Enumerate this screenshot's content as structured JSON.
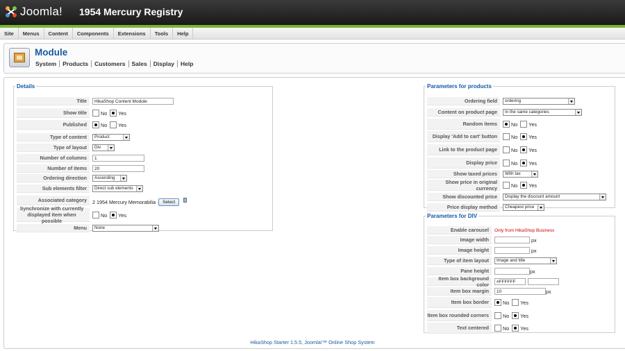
{
  "header": {
    "logo_text": "Joomla!",
    "site_title": "1954 Mercury Registry"
  },
  "menu": [
    "Site",
    "Menus",
    "Content",
    "Components",
    "Extensions",
    "Tools",
    "Help"
  ],
  "toolbar": {
    "title": "Module",
    "subnav": [
      "System",
      "Products",
      "Customers",
      "Sales",
      "Display",
      "Help"
    ]
  },
  "details": {
    "legend": "Details",
    "title_label": "Title",
    "title_value": "HikaShop Content Module",
    "show_title_label": "Show title",
    "published_label": "Published",
    "no": "No",
    "yes": "Yes",
    "type_content_label": "Type of content",
    "type_content_value": "Product",
    "type_layout_label": "Type of layout",
    "type_layout_value": "Div",
    "num_columns_label": "Number of columns",
    "num_columns_value": "1",
    "num_items_label": "Number of items",
    "num_items_value": "20",
    "ordering_dir_label": "Ordering direction",
    "ordering_dir_value": "Ascending",
    "sub_filter_label": "Sub elements filter",
    "sub_filter_value": "Direct sub elements",
    "assoc_cat_label": "Associated category",
    "assoc_cat_value": "2 1954 Mercury Memorabilia",
    "select_btn": "Select",
    "sync_label": "Synchronize with currently displayed item when possible",
    "menu_label": "Menu",
    "menu_value": "None"
  },
  "products": {
    "legend": "Parameters for products",
    "ordering_field_label": "Ordering field",
    "ordering_field_value": "ordering",
    "content_page_label": "Content on product page",
    "content_page_value": "In the same categories",
    "random_label": "Random items",
    "add_cart_label": "Display 'Add to cart' button",
    "link_label": "Link to the product page",
    "display_price_label": "Display price",
    "taxed_label": "Show taxed prices",
    "taxed_value": "With tax",
    "orig_currency_label": "Show price in original currency",
    "discounted_label": "Show discounted price",
    "discounted_value": "Display the discount amount",
    "price_method_label": "Price display method",
    "price_method_value": "Cheapest price"
  },
  "div": {
    "legend": "Parameters for DIV",
    "carousel_label": "Enable carousel",
    "carousel_note": "Only from HikaShop Business",
    "img_width_label": "Image width",
    "img_height_label": "Image height",
    "px": "px",
    "item_layout_label": "Type of item layout",
    "item_layout_value": "Image and title",
    "pane_height_label": "Pane height",
    "bg_color_label": "Item box background color",
    "bg_color_value": "#FFFFFF",
    "margin_label": "Item box margin",
    "margin_value": "10",
    "border_label": "Item box border",
    "rounded_label": "Item box rounded corners",
    "centered_label": "Text centered"
  },
  "footer": "HikaShop Starter 1.5.5, Joomla!™ Online Shop System",
  "colors": {
    "accent": "#1559a4",
    "green_bar": "#7ab531",
    "header_bg": "#1a1a1a"
  }
}
